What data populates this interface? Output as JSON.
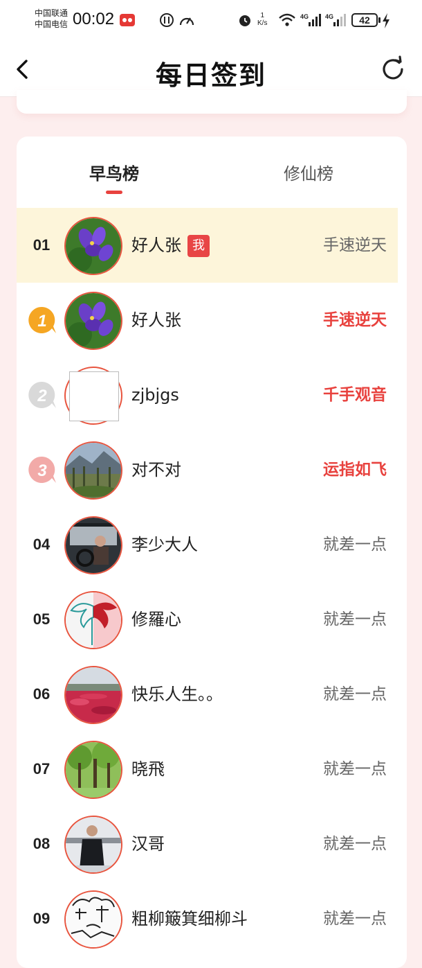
{
  "status_bar": {
    "carrier_1": "中国联通",
    "carrier_2": "中国电信",
    "time": "00:02",
    "net_speed_value": "1",
    "net_speed_unit": "K/s",
    "battery": "42"
  },
  "header": {
    "title": "每日签到"
  },
  "tabs": [
    {
      "label": "早鸟榜",
      "active": true
    },
    {
      "label": "修仙榜",
      "active": false
    }
  ],
  "me_badge": "我",
  "rows": [
    {
      "rank": "01",
      "name": "好人张",
      "title": "手速逆天",
      "is_me": true
    },
    {
      "rank": "1",
      "name": "好人张",
      "title": "手速逆天",
      "medal": "gold"
    },
    {
      "rank": "2",
      "name": "zjbjgs",
      "title": "千手观音",
      "medal": "silver"
    },
    {
      "rank": "3",
      "name": "对不对",
      "title": "运指如飞",
      "medal": "bronze"
    },
    {
      "rank": "04",
      "name": "李少大人",
      "title": "就差一点"
    },
    {
      "rank": "05",
      "name": "修羅心",
      "title": "就差一点"
    },
    {
      "rank": "06",
      "name": "快乐人生。。",
      "title": "就差一点"
    },
    {
      "rank": "07",
      "name": "晓飛",
      "title": "就差一点"
    },
    {
      "rank": "08",
      "name": "汉哥",
      "title": "就差一点"
    },
    {
      "rank": "09",
      "name": "粗柳簸箕细柳斗",
      "title": "就差一点"
    }
  ],
  "colors": {
    "accent": "#e8423e",
    "me_row_bg": "#fdf5da",
    "page_bg": "#fdeeee"
  }
}
